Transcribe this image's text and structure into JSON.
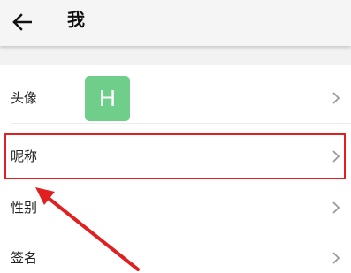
{
  "header": {
    "back_icon": "arrow-left-icon",
    "title": "我"
  },
  "rows": [
    {
      "label": "头像",
      "chevron_icon": "chevron-right-icon"
    },
    {
      "label": "昵称",
      "chevron_icon": "chevron-right-icon"
    },
    {
      "label": "性别",
      "chevron_icon": "chevron-right-icon"
    },
    {
      "label": "签名",
      "chevron_icon": "chevron-right-icon"
    }
  ],
  "avatar": {
    "initial": "H",
    "background_color": "#6fcf8a"
  },
  "annotation": {
    "highlight_color": "#e02020",
    "highlighted_row": "昵称"
  }
}
